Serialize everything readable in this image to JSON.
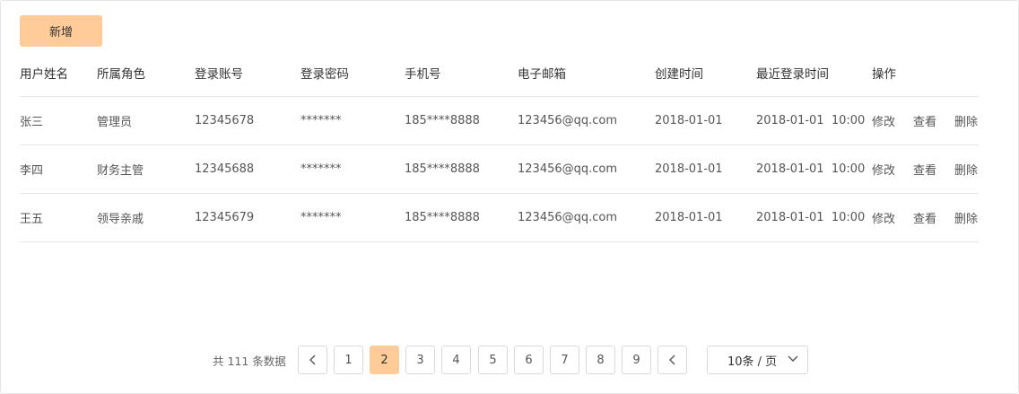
{
  "toolbar": {
    "add_label": "新增"
  },
  "table": {
    "columns": [
      "用户姓名",
      "所属角色",
      "登录账号",
      "登录密码",
      "手机号",
      "电子邮箱",
      "创建时间",
      "最近登录时间",
      "操作"
    ],
    "rows": [
      {
        "name": "张三",
        "role": "管理员",
        "account": "12345678",
        "password": "*******",
        "phone": "185****8888",
        "email": "123456@qq.com",
        "created": "2018-01-01",
        "last_login": "2018-01-01  10:00"
      },
      {
        "name": "李四",
        "role": "财务主管",
        "account": "12345688",
        "password": "*******",
        "phone": "185****8888",
        "email": "123456@qq.com",
        "created": "2018-01-01",
        "last_login": "2018-01-01  10:00"
      },
      {
        "name": "王五",
        "role": "领导亲戚",
        "account": "12345679",
        "password": "*******",
        "phone": "185****8888",
        "email": "123456@qq.com",
        "created": "2018-01-01",
        "last_login": "2018-01-01  10:00"
      }
    ],
    "actions": {
      "edit": "修改",
      "view": "查看",
      "delete": "删除"
    }
  },
  "pagination": {
    "total_text": "共 111 条数据",
    "pages": [
      "1",
      "2",
      "3",
      "4",
      "5",
      "6",
      "7",
      "8",
      "9"
    ],
    "current_page": "2",
    "page_size_label": "10条 / 页"
  },
  "colors": {
    "accent": "#ffcc99",
    "link": "#1e88c7",
    "border": "#e8e8e8"
  },
  "icons": {
    "prev": "chevron-left-icon",
    "next": "chevron-left-icon",
    "page_size": "chevron-down-icon"
  }
}
